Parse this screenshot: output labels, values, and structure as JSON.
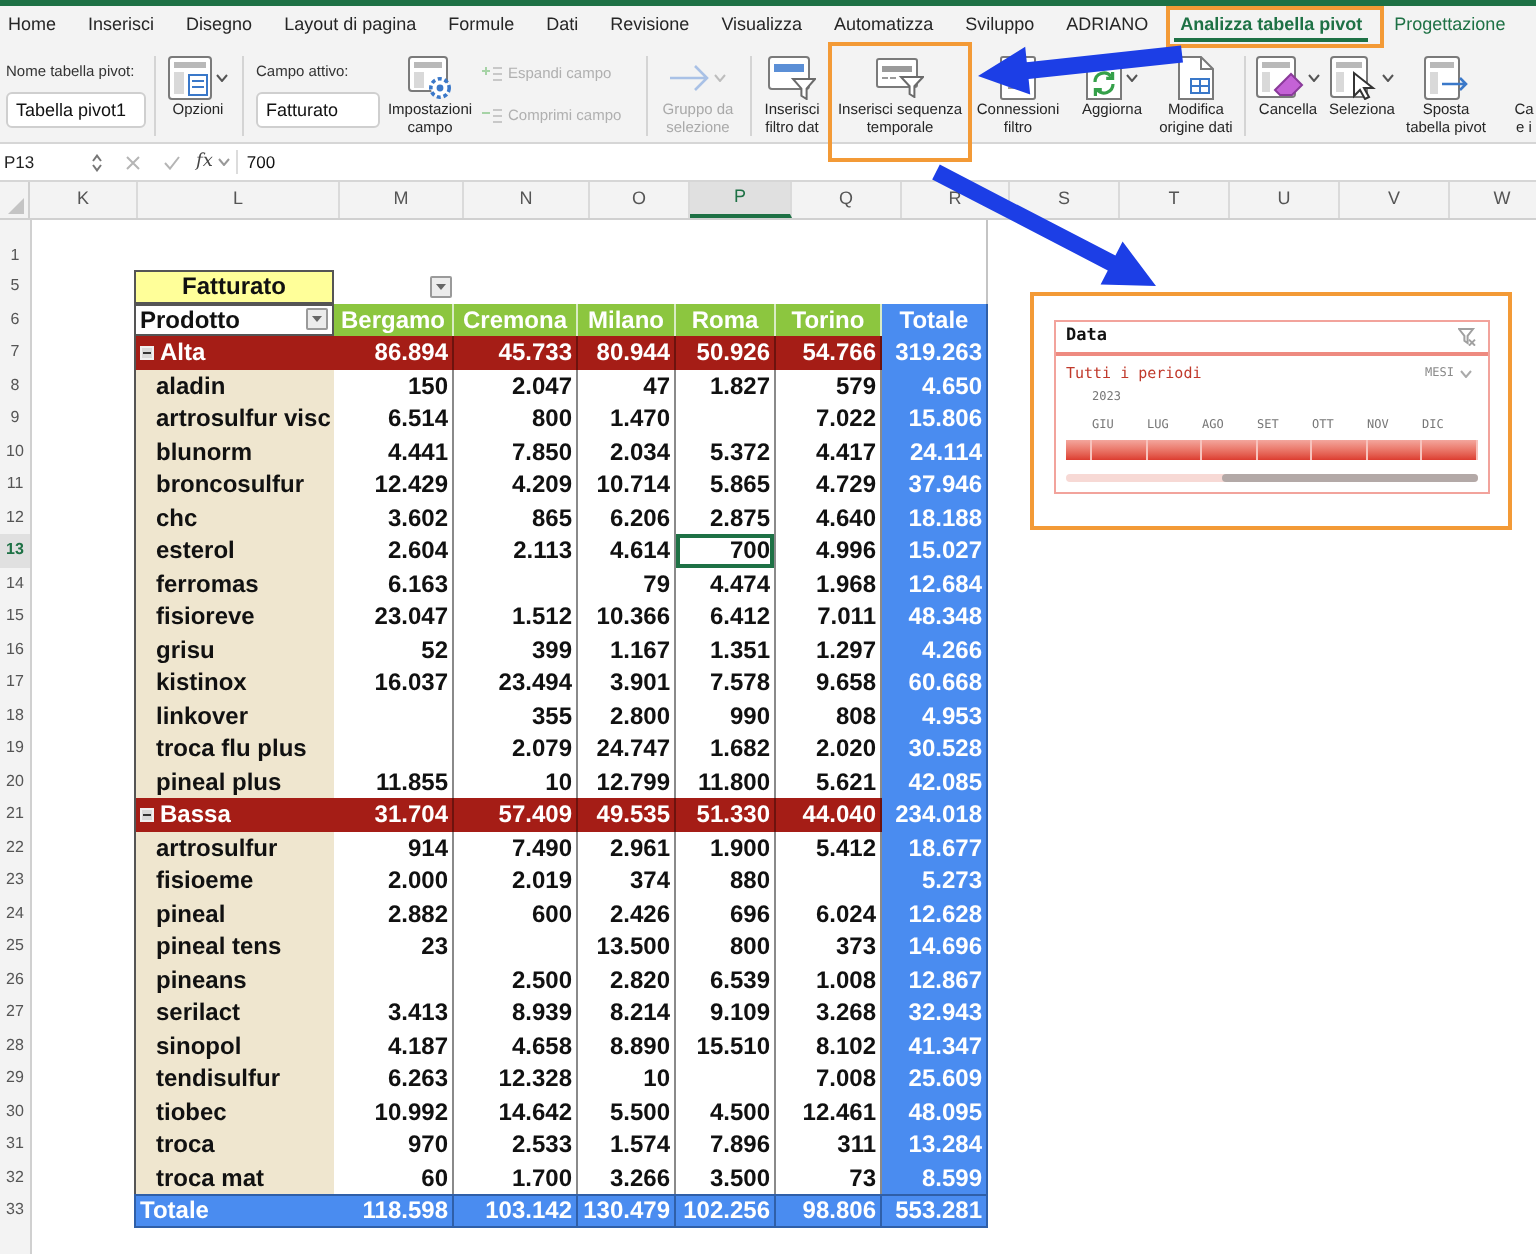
{
  "tabs": [
    {
      "label": "Home",
      "selected": false,
      "kind": "standard"
    },
    {
      "label": "Inserisci",
      "selected": false,
      "kind": "standard"
    },
    {
      "label": "Disegno",
      "selected": false,
      "kind": "standard"
    },
    {
      "label": "Layout di pagina",
      "selected": false,
      "kind": "standard"
    },
    {
      "label": "Formule",
      "selected": false,
      "kind": "standard"
    },
    {
      "label": "Dati",
      "selected": false,
      "kind": "standard"
    },
    {
      "label": "Revisione",
      "selected": false,
      "kind": "standard"
    },
    {
      "label": "Visualizza",
      "selected": false,
      "kind": "standard"
    },
    {
      "label": "Automatizza",
      "selected": false,
      "kind": "standard"
    },
    {
      "label": "Sviluppo",
      "selected": false,
      "kind": "standard"
    },
    {
      "label": "ADRIANO",
      "selected": false,
      "kind": "standard"
    },
    {
      "label": "Analizza tabella pivot",
      "selected": true,
      "kind": "contextual"
    },
    {
      "label": "Progettazione",
      "selected": false,
      "kind": "contextual"
    }
  ],
  "ribbon": [
    {
      "kind": "field",
      "label": "Nome tabella pivot:",
      "value": "Tabella pivot1"
    },
    {
      "kind": "separator"
    },
    {
      "kind": "button",
      "label": "Opzioni",
      "dropdown": true,
      "disabled": false
    },
    {
      "kind": "separator"
    },
    {
      "kind": "field",
      "label": "Campo attivo:",
      "value": "Fatturato"
    },
    {
      "kind": "button",
      "label": "Impostazioni\ncampo",
      "dropdown": false,
      "disabled": false
    },
    {
      "kind": "stack",
      "items": [
        {
          "label": "Espandi campo",
          "disabled": true
        },
        {
          "label": "Comprimi campo",
          "disabled": true
        }
      ]
    },
    {
      "kind": "separator"
    },
    {
      "kind": "button",
      "label": "Gruppo da\nselezione",
      "dropdown": true,
      "disabled": true
    },
    {
      "kind": "separator"
    },
    {
      "kind": "button",
      "label": "Inserisci\nfiltro dat",
      "dropdown": false,
      "disabled": false
    },
    {
      "kind": "button",
      "label": "Inserisci sequenza\ntemporale",
      "dropdown": false,
      "disabled": false
    },
    {
      "kind": "button",
      "label": "Connessioni\nfiltro",
      "dropdown": false,
      "disabled": false
    },
    {
      "kind": "button",
      "label": "Aggiorna",
      "dropdown": true,
      "disabled": false
    },
    {
      "kind": "button",
      "label": "Modifica\norigine dati",
      "dropdown": false,
      "disabled": false
    },
    {
      "kind": "separator"
    },
    {
      "kind": "button",
      "label": "Cancella",
      "dropdown": true,
      "disabled": false
    },
    {
      "kind": "button",
      "label": "Seleziona",
      "dropdown": true,
      "disabled": false
    },
    {
      "kind": "button",
      "label": "Sposta\ntabella pivot",
      "dropdown": false,
      "disabled": false
    },
    {
      "kind": "button",
      "label": "Ca\ne i",
      "dropdown": false,
      "disabled": false
    }
  ],
  "formula_bar": {
    "name_box": "P13",
    "function_label": "fx",
    "content": "700"
  },
  "sheet": {
    "columns": [
      {
        "label": "K",
        "selected": false
      },
      {
        "label": "L",
        "selected": false
      },
      {
        "label": "M",
        "selected": false
      },
      {
        "label": "N",
        "selected": false
      },
      {
        "label": "O",
        "selected": false
      },
      {
        "label": "P",
        "selected": true
      },
      {
        "label": "Q",
        "selected": false
      },
      {
        "label": "R",
        "selected": false
      },
      {
        "label": "S",
        "selected": false
      },
      {
        "label": "T",
        "selected": false
      },
      {
        "label": "U",
        "selected": false
      },
      {
        "label": "V",
        "selected": false
      },
      {
        "label": "W",
        "selected": false
      }
    ],
    "rows": [
      {
        "label": "1",
        "selected": false
      },
      {
        "label": "5",
        "selected": false
      },
      {
        "label": "6",
        "selected": false
      },
      {
        "label": "7",
        "selected": false
      },
      {
        "label": "8",
        "selected": false
      },
      {
        "label": "9",
        "selected": false
      },
      {
        "label": "10",
        "selected": false
      },
      {
        "label": "11",
        "selected": false
      },
      {
        "label": "12",
        "selected": false
      },
      {
        "label": "13",
        "selected": true
      },
      {
        "label": "14",
        "selected": false
      },
      {
        "label": "15",
        "selected": false
      },
      {
        "label": "16",
        "selected": false
      },
      {
        "label": "17",
        "selected": false
      },
      {
        "label": "18",
        "selected": false
      },
      {
        "label": "19",
        "selected": false
      },
      {
        "label": "20",
        "selected": false
      },
      {
        "label": "21",
        "selected": false
      },
      {
        "label": "22",
        "selected": false
      },
      {
        "label": "23",
        "selected": false
      },
      {
        "label": "24",
        "selected": false
      },
      {
        "label": "25",
        "selected": false
      },
      {
        "label": "26",
        "selected": false
      },
      {
        "label": "27",
        "selected": false
      },
      {
        "label": "28",
        "selected": false
      },
      {
        "label": "29",
        "selected": false
      },
      {
        "label": "30",
        "selected": false
      },
      {
        "label": "31",
        "selected": false
      },
      {
        "label": "32",
        "selected": false
      },
      {
        "label": "33",
        "selected": false
      }
    ]
  },
  "pivot": {
    "value_field": "Fatturato",
    "row_field": "Prodotto",
    "columns": [
      "Bergamo",
      "Cremona",
      "Milano",
      "Roma",
      "Torino"
    ],
    "total_header": "Totale",
    "groups": [
      {
        "name": "Alta",
        "expanded": true,
        "bergamo": "86.894",
        "cremona": "45.733",
        "milano": "80.944",
        "roma": "50.926",
        "torino": "54.766",
        "total": "319.263",
        "items": [
          {
            "name": "aladin",
            "bergamo": "150",
            "cremona": "2.047",
            "milano": "47",
            "roma": "1.827",
            "torino": "579",
            "total": "4.650"
          },
          {
            "name": "artrosulfur visc",
            "bergamo": "6.514",
            "cremona": "800",
            "milano": "1.470",
            "torino": "7.022",
            "total": "15.806"
          },
          {
            "name": "blunorm",
            "bergamo": "4.441",
            "cremona": "7.850",
            "milano": "2.034",
            "roma": "5.372",
            "torino": "4.417",
            "total": "24.114"
          },
          {
            "name": "broncosulfur",
            "bergamo": "12.429",
            "cremona": "4.209",
            "milano": "10.714",
            "roma": "5.865",
            "torino": "4.729",
            "total": "37.946"
          },
          {
            "name": "chc",
            "bergamo": "3.602",
            "cremona": "865",
            "milano": "6.206",
            "roma": "2.875",
            "torino": "4.640",
            "total": "18.188"
          },
          {
            "name": "esterol",
            "bergamo": "2.604",
            "cremona": "2.113",
            "milano": "4.614",
            "roma": "700",
            "torino": "4.996",
            "total": "15.027"
          },
          {
            "name": "ferromas",
            "bergamo": "6.163",
            "milano": "79",
            "roma": "4.474",
            "torino": "1.968",
            "total": "12.684"
          },
          {
            "name": "fisioreve",
            "bergamo": "23.047",
            "cremona": "1.512",
            "milano": "10.366",
            "roma": "6.412",
            "torino": "7.011",
            "total": "48.348"
          },
          {
            "name": "grisu",
            "bergamo": "52",
            "cremona": "399",
            "milano": "1.167",
            "roma": "1.351",
            "torino": "1.297",
            "total": "4.266"
          },
          {
            "name": "kistinox",
            "bergamo": "16.037",
            "cremona": "23.494",
            "milano": "3.901",
            "roma": "7.578",
            "torino": "9.658",
            "total": "60.668"
          },
          {
            "name": "linkover",
            "cremona": "355",
            "milano": "2.800",
            "roma": "990",
            "torino": "808",
            "total": "4.953"
          },
          {
            "name": "troca flu plus",
            "cremona": "2.079",
            "milano": "24.747",
            "roma": "1.682",
            "torino": "2.020",
            "total": "30.528"
          },
          {
            "name": "pineal plus",
            "bergamo": "11.855",
            "cremona": "10",
            "milano": "12.799",
            "roma": "11.800",
            "torino": "5.621",
            "total": "42.085"
          }
        ]
      },
      {
        "name": "Bassa",
        "expanded": true,
        "bergamo": "31.704",
        "cremona": "57.409",
        "milano": "49.535",
        "roma": "51.330",
        "torino": "44.040",
        "total": "234.018",
        "items": [
          {
            "name": "artrosulfur",
            "bergamo": "914",
            "cremona": "7.490",
            "milano": "2.961",
            "roma": "1.900",
            "torino": "5.412",
            "total": "18.677"
          },
          {
            "name": "fisioeme",
            "bergamo": "2.000",
            "cremona": "2.019",
            "milano": "374",
            "roma": "880",
            "total": "5.273"
          },
          {
            "name": "pineal",
            "bergamo": "2.882",
            "cremona": "600",
            "milano": "2.426",
            "roma": "696",
            "torino": "6.024",
            "total": "12.628"
          },
          {
            "name": "pineal tens",
            "bergamo": "23",
            "milano": "13.500",
            "roma": "800",
            "torino": "373",
            "total": "14.696"
          },
          {
            "name": "pineans",
            "cremona": "2.500",
            "milano": "2.820",
            "roma": "6.539",
            "torino": "1.008",
            "total": "12.867"
          },
          {
            "name": "serilact",
            "bergamo": "3.413",
            "cremona": "8.939",
            "milano": "8.214",
            "roma": "9.109",
            "torino": "3.268",
            "total": "32.943"
          },
          {
            "name": "sinopol",
            "bergamo": "4.187",
            "cremona": "4.658",
            "milano": "8.890",
            "roma": "15.510",
            "torino": "8.102",
            "total": "41.347"
          },
          {
            "name": "tendisulfur",
            "bergamo": "6.263",
            "cremona": "12.328",
            "milano": "10",
            "torino": "7.008",
            "total": "25.609"
          },
          {
            "name": "tiobec",
            "bergamo": "10.992",
            "cremona": "14.642",
            "milano": "5.500",
            "roma": "4.500",
            "torino": "12.461",
            "total": "48.095"
          },
          {
            "name": "troca",
            "bergamo": "970",
            "cremona": "2.533",
            "milano": "1.574",
            "roma": "7.896",
            "torino": "311",
            "total": "13.284"
          },
          {
            "name": "troca mat",
            "bergamo": "60",
            "cremona": "1.700",
            "milano": "3.266",
            "roma": "3.500",
            "torino": "73",
            "total": "8.599"
          }
        ]
      }
    ],
    "grand_total": {
      "label": "Totale",
      "bergamo": "118.598",
      "cremona": "103.142",
      "milano": "130.479",
      "roma": "102.256",
      "torino": "98.806",
      "total": "553.281"
    }
  },
  "timeline": {
    "title": "Data",
    "selection": "Tutti i periodi",
    "time_level": "MESI",
    "year": "2023",
    "months": [
      {
        "kind": "partial",
        "selected": true
      },
      {
        "kind": "month",
        "label": "GIU",
        "selected": true
      },
      {
        "kind": "month",
        "label": "LUG",
        "selected": true
      },
      {
        "kind": "month",
        "label": "AGO",
        "selected": true
      },
      {
        "kind": "month",
        "label": "SET",
        "selected": true
      },
      {
        "kind": "month",
        "label": "OTT",
        "selected": true
      },
      {
        "kind": "month",
        "label": "NOV",
        "selected": true
      },
      {
        "kind": "month",
        "label": "DIC",
        "selected": true
      }
    ]
  }
}
